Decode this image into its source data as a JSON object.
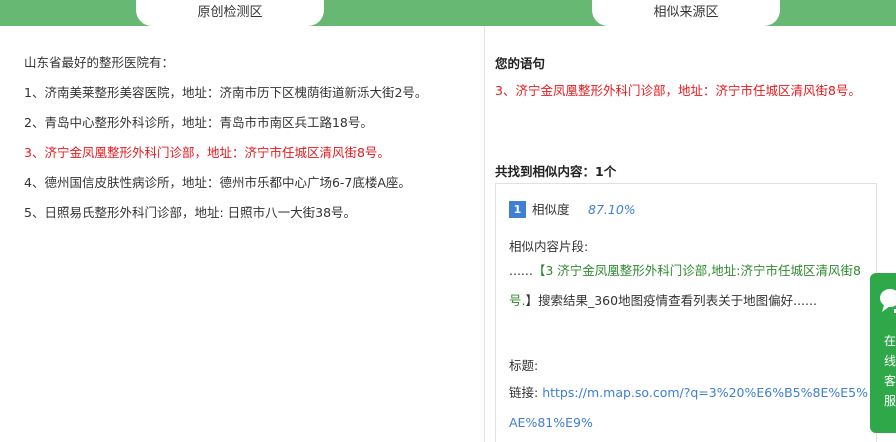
{
  "tabs": {
    "original": "原创检测区",
    "similar": "相似来源区"
  },
  "original_text": {
    "lines": [
      "山东省最好的整形医院有：",
      "1、济南美莱整形美容医院，地址：济南市历下区槐荫街道新泺大街2号。",
      "2、青岛中心整形外科诊所，地址：青岛市市南区兵工路18号。",
      "3、济宁金凤凰整形外科门诊部，地址：济宁市任城区清风街8号。",
      "4、德州国信皮肤性病诊所，地址：德州市乐都中心广场6-7底楼A座。",
      "5、日照易氏整形外科门诊部，地址: 日照市八一大街38号。"
    ],
    "highlight_index": 3,
    "highlight_color": "#e8191d"
  },
  "right_panel": {
    "your_sentence_label": "您的语句",
    "your_sentence": "3、济宁金凤凰整形外科门诊部，地址：济宁市任城区清风街8号。",
    "found_label": "共找到相似内容：1个",
    "result": {
      "rank": "1",
      "similarity_label": "相似度",
      "similarity_value": "87.10%",
      "fragment_label": "相似内容片段:",
      "fragment_prefix": "......",
      "fragment_match": "【3 济宁金凤凰整形外科门诊部,地址:济宁市任城区清风街8号.",
      "fragment_rest": "】搜索结果_360地图疫情查看列表关于地图偏好......",
      "title_label": "标题:",
      "link_label": "链接:",
      "link_url": "https://m.map.so.com/?q=3%20%E6%B5%8E%E5%AE%81%E9%"
    }
  },
  "side_widget": {
    "icon": "chat-icon",
    "text": "在线客服"
  },
  "colors": {
    "header_green": "#66b873",
    "accent_blue": "#3d7fd6",
    "match_green": "#2e8a2e",
    "side_green": "#2fa84a"
  }
}
